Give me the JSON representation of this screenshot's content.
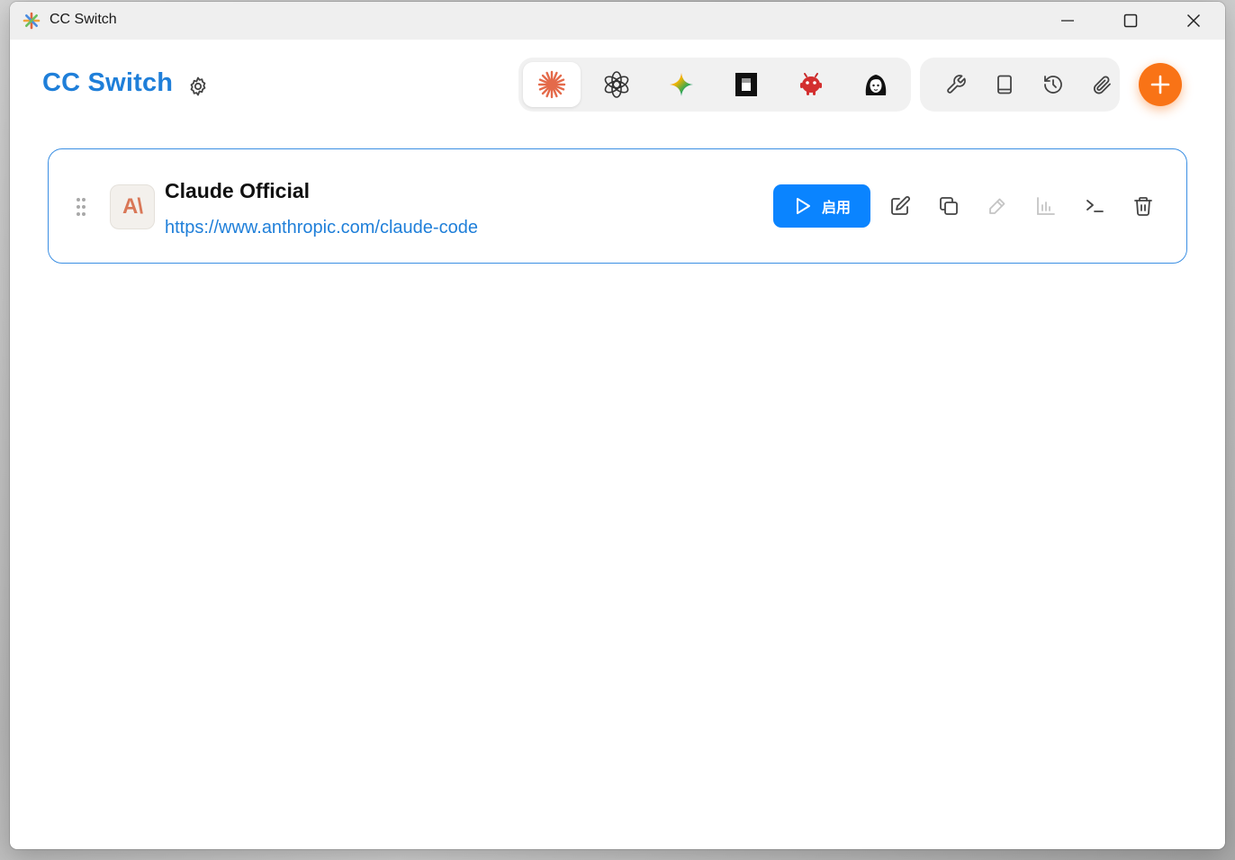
{
  "window": {
    "title": "CC Switch"
  },
  "header": {
    "brand": "CC Switch"
  },
  "provider": {
    "name": "Claude Official",
    "url": "https://www.anthropic.com/claude-code",
    "avatar_text": "A\\",
    "enable_label": "启用"
  },
  "colors": {
    "brand_blue": "#1f7fd9",
    "accent_orange": "#f97316",
    "enable_blue": "#0a84ff",
    "claude_orange": "#d97757"
  },
  "icons": {
    "app_tabs": [
      "claude-icon",
      "openai-icon",
      "gemini-icon",
      "cursor-icon",
      "android-icon",
      "avatar-icon"
    ],
    "tools": [
      "wrench-icon",
      "book-icon",
      "history-icon",
      "paperclip-icon"
    ],
    "card_actions": [
      "edit-icon",
      "copy-icon",
      "pen-icon",
      "stats-icon",
      "terminal-icon",
      "trash-icon"
    ]
  }
}
